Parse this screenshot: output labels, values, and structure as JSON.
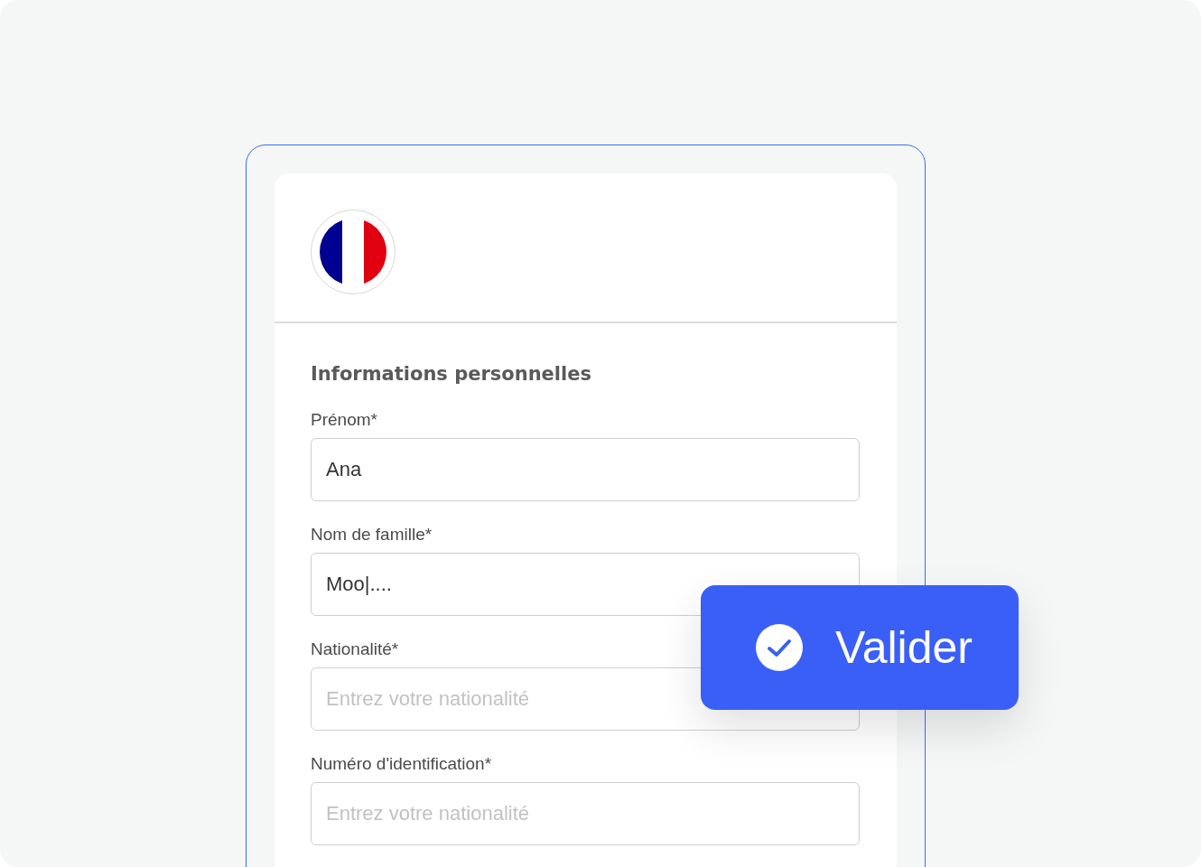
{
  "section_title": "Informations personnelles",
  "fields": [
    {
      "label": "Prénom*",
      "value": "Ana"
    },
    {
      "label": "Nom de famille*",
      "value": "Moo|...."
    },
    {
      "label": "Nationalité*",
      "placeholder": "Entrez votre nationalité"
    },
    {
      "label": "Numéro d'identification*",
      "placeholder": "Entrez votre nationalité"
    }
  ],
  "submit_button": {
    "label": "Valider"
  }
}
